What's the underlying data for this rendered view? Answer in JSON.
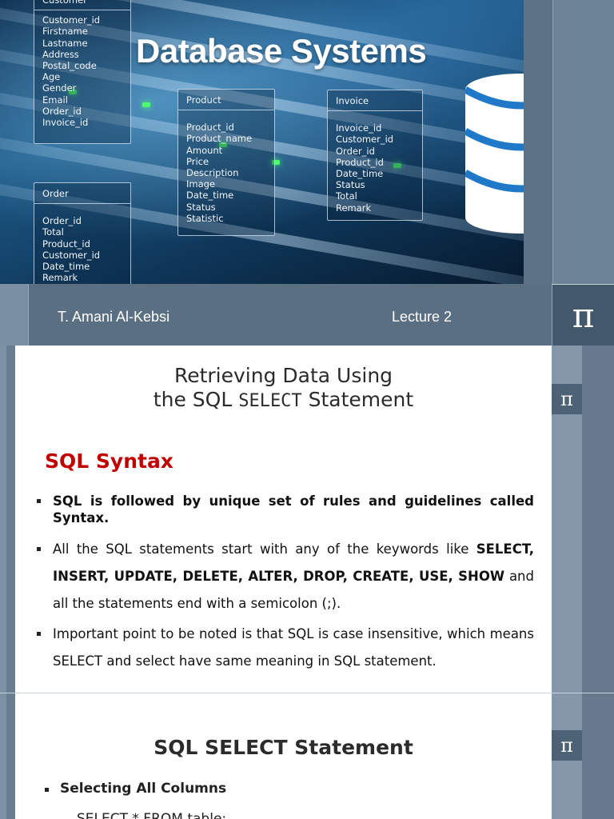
{
  "slide1": {
    "title": "Database Systems",
    "author": "T. Amani Al-Kebsi",
    "lecture": "Lecture 2",
    "pi_symbol": "π",
    "tables": {
      "customer": {
        "title": "Customer",
        "fields": [
          "Customer_id",
          "Firstname",
          "Lastname",
          "Address",
          "Postal_code",
          "Age",
          "Gender",
          "Email",
          "Order_id",
          "Invoice_id"
        ]
      },
      "product": {
        "title": "Product",
        "fields": [
          "Product_id",
          "Product_name",
          "Amount",
          "Price",
          "Description",
          "Image",
          "Date_time",
          "Status",
          "Statistic"
        ]
      },
      "invoice": {
        "title": "Invoice",
        "fields": [
          "Invoice_id",
          "Customer_id",
          "Order_id",
          "Product_id",
          "Date_time",
          "Status",
          "Total",
          "Remark"
        ]
      },
      "order": {
        "title": "Order",
        "fields": [
          "Order_id",
          "Total",
          "Product_id",
          "Customer_id",
          "Date_time",
          "Remark"
        ]
      }
    }
  },
  "slide2": {
    "title_line1": "Retrieving Data Using",
    "title_line2_prefix": "the SQL ",
    "title_line2_code": "SELECT",
    "title_line2_suffix": " Statement",
    "heading": "SQL Syntax",
    "pi_symbol": "π",
    "bullet1": "SQL is followed by unique set of rules and guidelines called Syntax.",
    "bullet2_prefix": "All the SQL statements start with any of the keywords like ",
    "bullet2_keywords": "SELECT, INSERT, UPDATE, DELETE, ALTER, DROP, CREATE, USE, SHOW",
    "bullet2_suffix": " and all the statements end with a semicolon (;).",
    "bullet3": "Important point to be noted is that SQL is case insensitive, which means SELECT and select have same meaning in SQL statement."
  },
  "slide3": {
    "title": "SQL SELECT Statement",
    "pi_symbol": "π",
    "bullet1": "Selecting All Columns",
    "cut_line": "SELECT * FROM table;"
  },
  "colors": {
    "heading_red": "#c00000",
    "frame_slate": "#5f7283",
    "pi_box": "#4d6275"
  }
}
